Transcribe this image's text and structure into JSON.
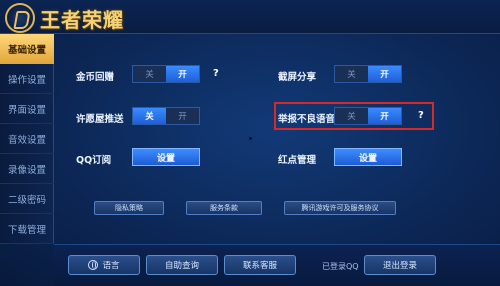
{
  "app": {
    "title": "王者荣耀"
  },
  "sidebar": {
    "items": [
      {
        "label": "基础设置",
        "active": true
      },
      {
        "label": "操作设置",
        "active": false
      },
      {
        "label": "界面设置",
        "active": false
      },
      {
        "label": "音效设置",
        "active": false
      },
      {
        "label": "录像设置",
        "active": false
      },
      {
        "label": "二级密码",
        "active": false
      },
      {
        "label": "下载管理",
        "active": false
      }
    ]
  },
  "settings": {
    "coin_gift": {
      "label": "金币回赠",
      "off": "关",
      "on": "开",
      "state": "on",
      "help": "?"
    },
    "screenshot_share": {
      "label": "截屏分享",
      "off": "关",
      "on": "开",
      "state": "on"
    },
    "wish_push": {
      "label": "许愿屋推送",
      "off": "关",
      "on": "开",
      "state": "off_active"
    },
    "report_voice": {
      "label": "举报不良语音",
      "off": "关",
      "on": "开",
      "state": "on",
      "help": "?"
    },
    "qq_subscribe": {
      "label": "QQ订阅",
      "button": "设置"
    },
    "red_dot": {
      "label": "红点管理",
      "button": "设置"
    }
  },
  "links": {
    "privacy": "隐私策略",
    "terms": "服务条款",
    "license": "腾讯游戏许可及服务协议"
  },
  "bottom": {
    "language": "语言",
    "self_query": "自助查询",
    "support": "联系客服",
    "logged_in": "已登录QQ",
    "logout": "退出登录"
  },
  "colors": {
    "accent_blue": "#1f5fd8",
    "active_tab": "#e2a63a",
    "highlight": "#d42a2a"
  }
}
